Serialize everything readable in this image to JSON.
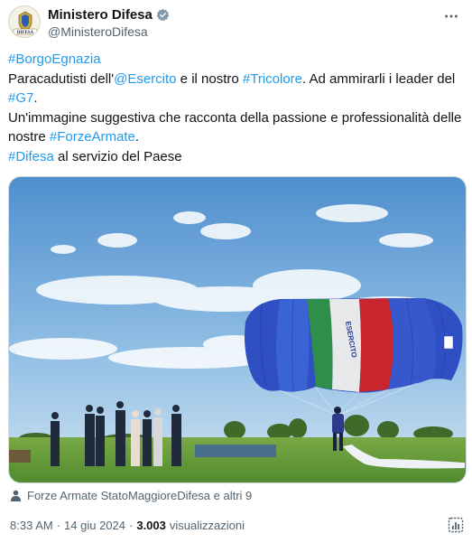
{
  "author": {
    "display_name": "Ministero Difesa",
    "handle": "@MinisteroDifesa",
    "avatar_text": "DIFESA",
    "verified": true
  },
  "tweet": {
    "hashtag_borgo": "#BorgoEgnazia",
    "line2_pre": "Paracadutisti dell'",
    "mention_esercito": "@Esercito",
    "line2_mid": " e il nostro ",
    "hashtag_tricolore": "#Tricolore",
    "line2_post": ". Ad ammirarli i leader del",
    "hashtag_g7": "#G7",
    "line3_post": ".",
    "line4_pre": "Un'immagine suggestiva che racconta della passione e professionalità delle nostre ",
    "hashtag_forze": "#ForzeArmate",
    "line4_post": ".",
    "hashtag_difesa": "#Difesa",
    "line5_post": " al servizio del Paese"
  },
  "media": {
    "canopy_text": "ESERCITO",
    "colors": {
      "sky": "#6aa3d6",
      "canopy_blue": "#3358c9",
      "green": "#2f8f4a",
      "white": "#f2f2f0",
      "red": "#c8262c",
      "grass": "#6a9a3c"
    }
  },
  "tagged": {
    "text": "Forze Armate StatoMaggioreDifesa e altri 9"
  },
  "meta": {
    "time": "8:33 AM",
    "sep1": "·",
    "date": "14 giu 2024",
    "sep2": "·",
    "views_count": "3.003",
    "views_label": "visualizzazioni"
  }
}
